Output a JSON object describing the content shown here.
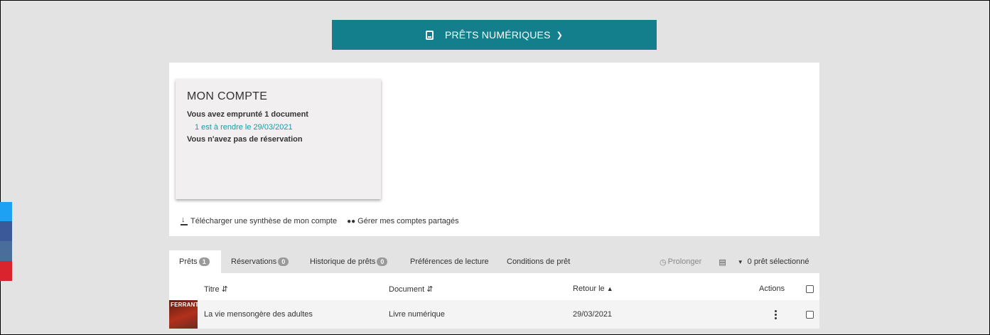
{
  "topbar": {
    "label": "PRÊTS NUMÉRIQUES",
    "icon": "tablet-icon",
    "color": "#137f8c"
  },
  "account": {
    "title": "MON COMPTE",
    "borrowed": "Vous avez emprunté 1 document",
    "due": "1 est à rendre le 29/03/2021",
    "reservations": "Vous n'avez pas de réservation"
  },
  "links": {
    "download": "Télécharger une synthèse de mon compte",
    "shared": "Gérer mes comptes partagés"
  },
  "tabs": [
    {
      "label": "Prêts",
      "count": "1"
    },
    {
      "label": "Réservations",
      "count": "0"
    },
    {
      "label": "Historique de prêts",
      "count": "0"
    },
    {
      "label": "Préférences de lecture",
      "count": ""
    },
    {
      "label": "Conditions de prêt",
      "count": ""
    }
  ],
  "tools": {
    "prolong": "Prolonger",
    "selected": "0 prêt sélectionné"
  },
  "table": {
    "headers": {
      "title": "Titre",
      "document": "Document",
      "return": "Retour le",
      "actions": "Actions"
    },
    "rows": [
      {
        "cover_text": "FERRANTE",
        "title": "La vie mensongère des adultes",
        "document": "Livre numérique",
        "return": "29/03/2021"
      }
    ]
  },
  "social_colors": [
    "#1da1f2",
    "#3b5998",
    "#4a6e9b",
    "#d9232d"
  ]
}
